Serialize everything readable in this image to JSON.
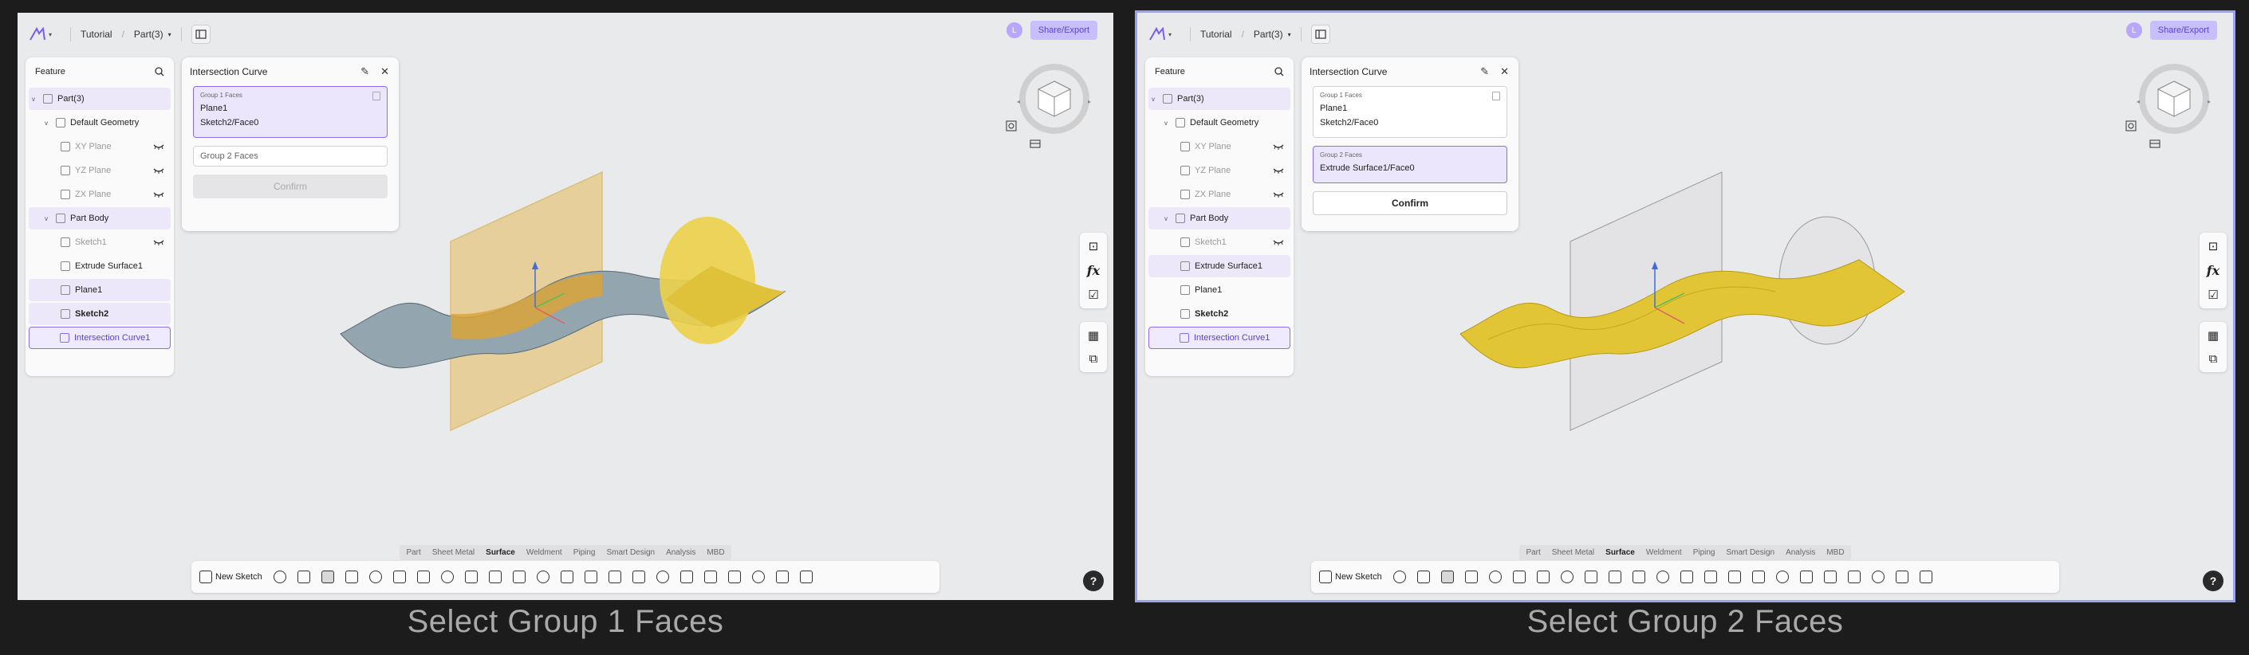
{
  "captions": {
    "left": "Select Group 1 Faces",
    "right": "Select Group 2 Faces"
  },
  "app": {
    "breadcrumb": [
      "Tutorial",
      "Part(3)"
    ],
    "share_label": "Share/Export",
    "avatar_initial": "L"
  },
  "feature_tree": {
    "title": "Feature",
    "items": [
      {
        "label": "Part(3)"
      },
      {
        "label": "Default Geometry"
      },
      {
        "label": "XY Plane"
      },
      {
        "label": "YZ Plane"
      },
      {
        "label": "ZX Plane"
      },
      {
        "label": "Part Body"
      },
      {
        "label": "Sketch1"
      },
      {
        "label": "Extrude Surface1"
      },
      {
        "label": "Plane1"
      },
      {
        "label": "Sketch2"
      },
      {
        "label": "Intersection Curve1"
      }
    ]
  },
  "dialog": {
    "title": "Intersection Curve",
    "group1_label": "Group 1 Faces",
    "group1_items": [
      "Plane1",
      "Sketch2/Face0"
    ],
    "group2_label": "Group 2 Faces",
    "group2_items": [
      "Extrude Surface1/Face0"
    ],
    "confirm_label": "Confirm"
  },
  "bottom_tabs": [
    "Part",
    "Sheet Metal",
    "Surface",
    "Weldment",
    "Piping",
    "Smart Design",
    "Analysis",
    "MBD"
  ],
  "active_tab": "Surface",
  "toolbar": {
    "new_sketch_label": "New Sketch"
  },
  "help_label": "?",
  "colors": {
    "accent": "#8b6df2",
    "surface_yellow": "#e3c53a",
    "surface_blue": "#8fa3ae"
  }
}
